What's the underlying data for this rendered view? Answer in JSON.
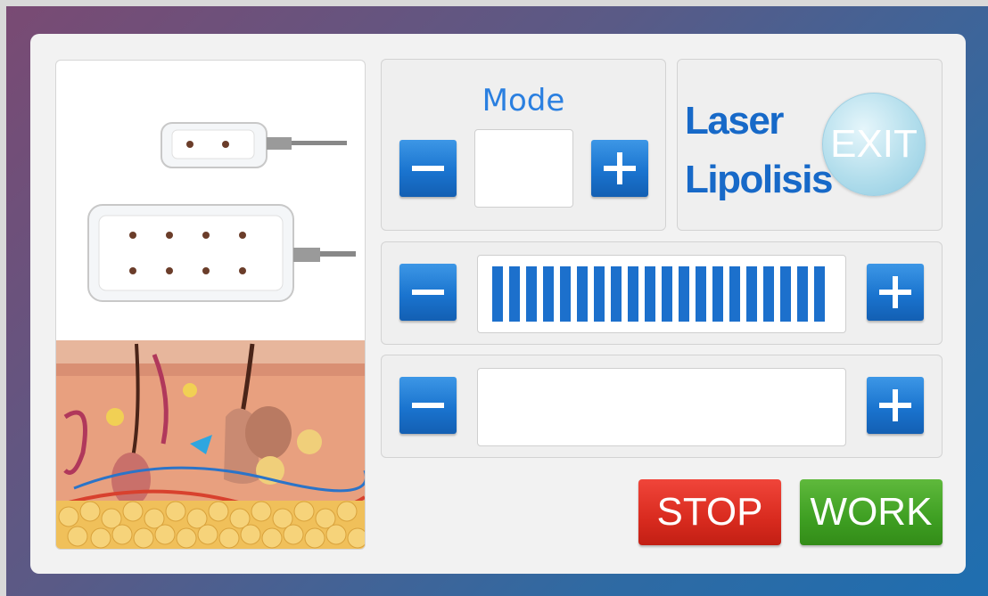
{
  "mode": {
    "label": "Mode",
    "value": "",
    "minus_icon": "minus-icon",
    "plus_icon": "plus-icon"
  },
  "title": {
    "line1": "Laser",
    "line2": "Lipolisis"
  },
  "exit_label": "EXIT",
  "intensity": {
    "level_fraction": 1.0,
    "segments": 20,
    "color": "#1c70cc"
  },
  "time": {
    "value": ""
  },
  "actions": {
    "stop_label": "STOP",
    "work_label": "WORK"
  },
  "colors": {
    "accent_blue": "#1a74cf",
    "stop_red": "#d92b1f",
    "work_green": "#3e9f22",
    "exit_cyan": "#b3deec"
  }
}
